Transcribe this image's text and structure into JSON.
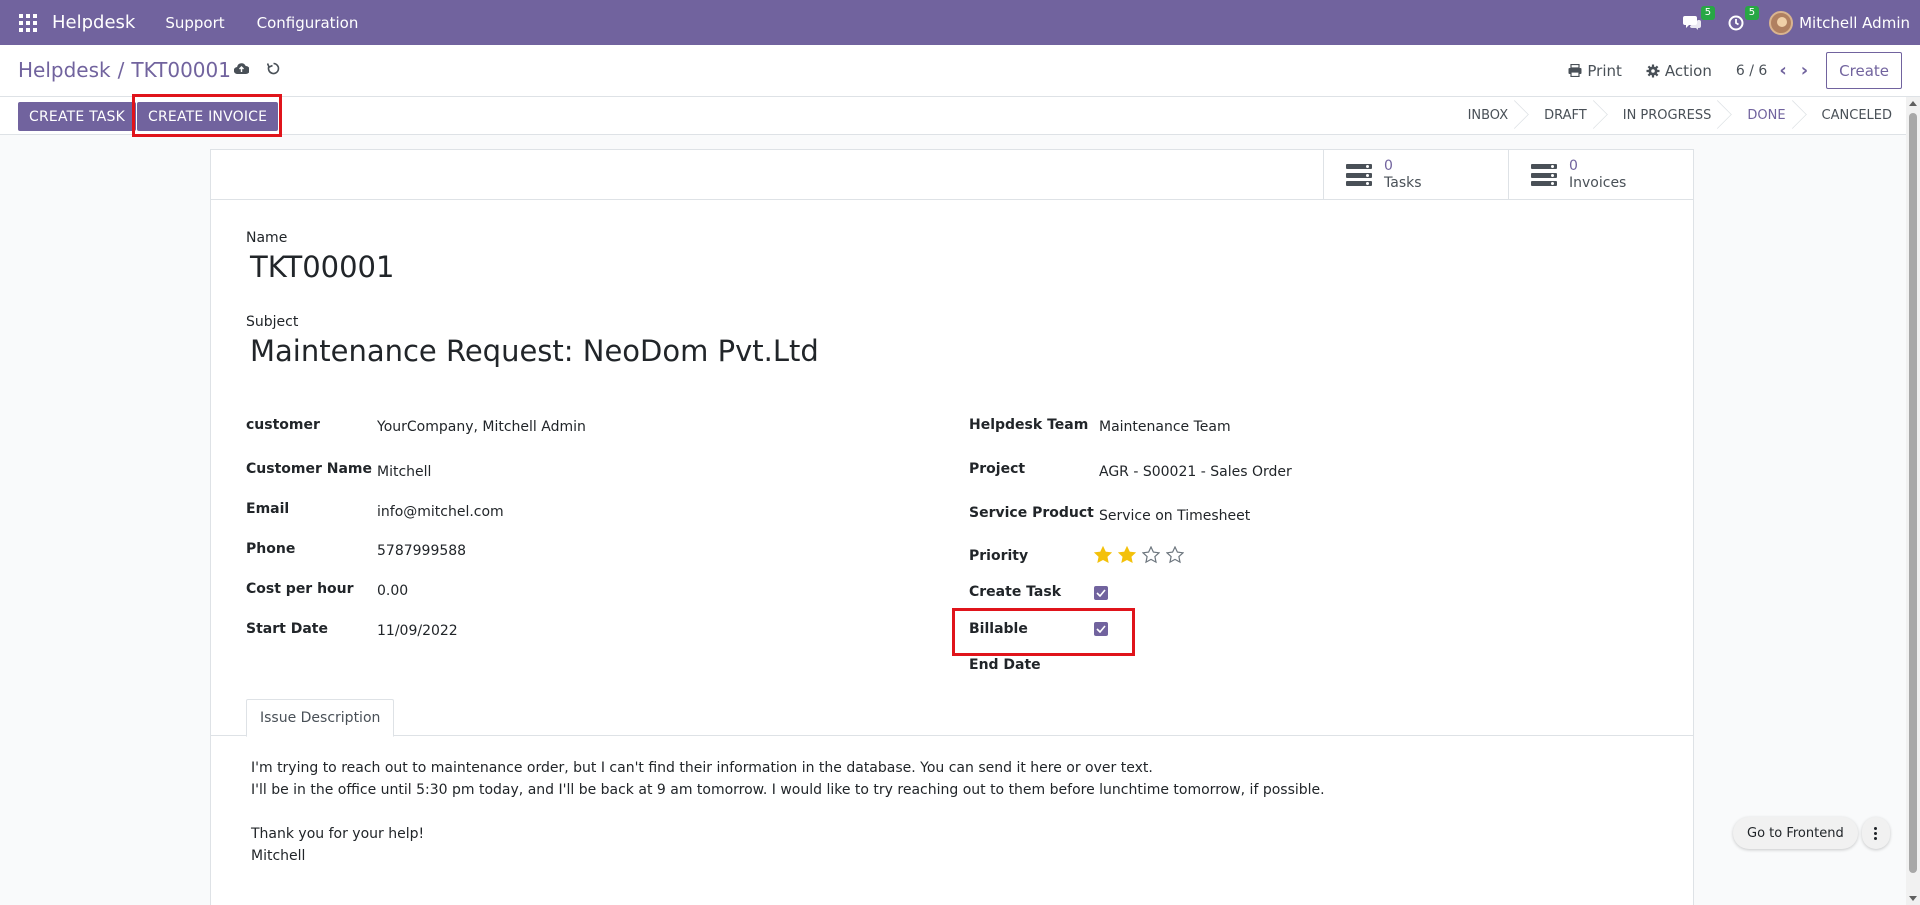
{
  "navbar": {
    "brand": "Helpdesk",
    "menus": [
      "Support",
      "Configuration"
    ],
    "messages_count": "5",
    "activities_count": "5",
    "user_name": "Mitchell Admin"
  },
  "control_panel": {
    "breadcrumb_root": "Helpdesk",
    "breadcrumb_sep": "/",
    "breadcrumb_current": "TKT00001",
    "print_label": "Print",
    "action_label": "Action",
    "pager": "6 / 6",
    "create_label": "Create"
  },
  "statusbar": {
    "create_task_label": "CREATE TASK",
    "create_invoice_label": "CREATE INVOICE",
    "stages": [
      "INBOX",
      "DRAFT",
      "IN PROGRESS",
      "DONE",
      "CANCELED"
    ],
    "active_stage": "DONE"
  },
  "smart_buttons": {
    "tasks": {
      "value": "0",
      "label": "Tasks"
    },
    "invoices": {
      "value": "0",
      "label": "Invoices"
    }
  },
  "form": {
    "name_label": "Name",
    "name_value": "TKT00001",
    "subject_label": "Subject",
    "subject_value": "Maintenance Request: NeoDom Pvt.Ltd",
    "left": {
      "customer_label": "customer",
      "customer_value": "YourCompany, Mitchell Admin",
      "customer_name_label": "Customer Name",
      "customer_name_value": "Mitchell",
      "email_label": "Email",
      "email_value": "info@mitchel.com",
      "phone_label": "Phone",
      "phone_value": "5787999588",
      "cost_label": "Cost per hour",
      "cost_value": "0.00",
      "start_date_label": "Start Date",
      "start_date_value": "11/09/2022"
    },
    "right": {
      "team_label": "Helpdesk Team",
      "team_value": "Maintenance Team",
      "project_label": "Project",
      "project_value": "AGR - S00021 - Sales Order",
      "service_label": "Service Product",
      "service_value": "Service on Timesheet",
      "priority_label": "Priority",
      "priority_value": 2,
      "priority_max": 4,
      "create_task_label": "Create Task",
      "create_task_checked": true,
      "billable_label": "Billable",
      "billable_checked": true,
      "end_date_label": "End Date"
    }
  },
  "notebook": {
    "tab_label": "Issue Description",
    "lines": [
      "I'm trying to reach out to maintenance order, but I can't find their information in the database. You can send it here or over text.",
      "I'll be in the office until 5:30 pm today, and I'll be back at 9 am tomorrow. I would like to try reaching out to them before lunchtime tomorrow, if possible.",
      "Thank you for your help!",
      "Mitchell"
    ]
  },
  "frontend_button": "Go to Frontend",
  "colors": {
    "primary": "#71639e",
    "highlight": "#e0141b",
    "star": "#f3c10b",
    "badge": "#28a745"
  }
}
